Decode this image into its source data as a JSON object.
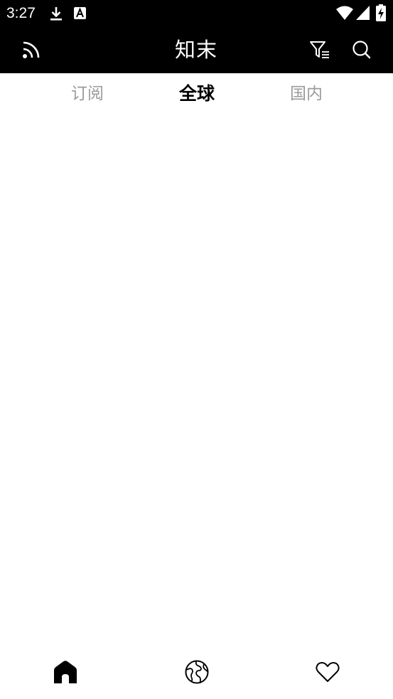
{
  "status_bar": {
    "time": "3:27",
    "icons": [
      "download-icon",
      "a-notification-icon",
      "wifi-icon",
      "cell-signal-icon",
      "battery-charging-icon"
    ]
  },
  "app_bar": {
    "title": "知末",
    "left_icon": "rss-feed-icon",
    "right_icons": [
      "filter-list-icon",
      "search-icon"
    ]
  },
  "tabs": [
    {
      "label": "订阅",
      "active": false
    },
    {
      "label": "全球",
      "active": true
    },
    {
      "label": "国内",
      "active": false
    }
  ],
  "bottom_nav": {
    "items": [
      {
        "icon": "home-icon",
        "active": true
      },
      {
        "icon": "globe-icon",
        "active": false
      },
      {
        "icon": "heart-icon",
        "active": false
      }
    ]
  },
  "colors": {
    "bar_background": "#000000",
    "active_tab": "#000000",
    "inactive_tab": "#9b9b9b",
    "page_background": "#ffffff"
  }
}
